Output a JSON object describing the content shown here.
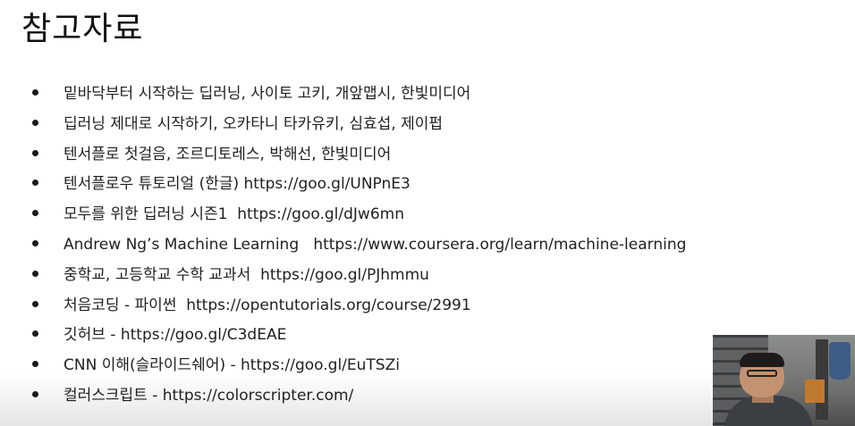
{
  "slide": {
    "title": "참고자료",
    "references": [
      "밑바닥부터 시작하는 딥러닝, 사이토 고키, 개앞맵시, 한빛미디어",
      "딥러닝 제대로 시작하기, 오카타니 타카유키, 심효섭, 제이펍",
      "텐서플로 첫걸음, 조르디토레스, 박해선, 한빛미디어",
      "텐서플로우 튜토리얼 (한글) https://goo.gl/UNPnE3",
      "모두를 위한 딥러닝 시즌1  https://goo.gl/dJw6mn",
      "Andrew Ng’s Machine Learning   https://www.coursera.org/learn/machine-learning",
      "중학교, 고등학교 수학 교과서  https://goo.gl/PJhmmu",
      "처음코딩 - 파이썬  https://opentutorials.org/course/2991",
      "깃허브 - https://goo.gl/C3dEAE",
      "CNN 이해(슬라이드쉐어) - https://goo.gl/EuTSZi",
      "컬러스크립트 - https://colorscripter.com/"
    ]
  },
  "overlay": {
    "webcam": "presenter-webcam"
  },
  "colors": {
    "background": "#ffffff",
    "text": "#1a1a1a"
  }
}
